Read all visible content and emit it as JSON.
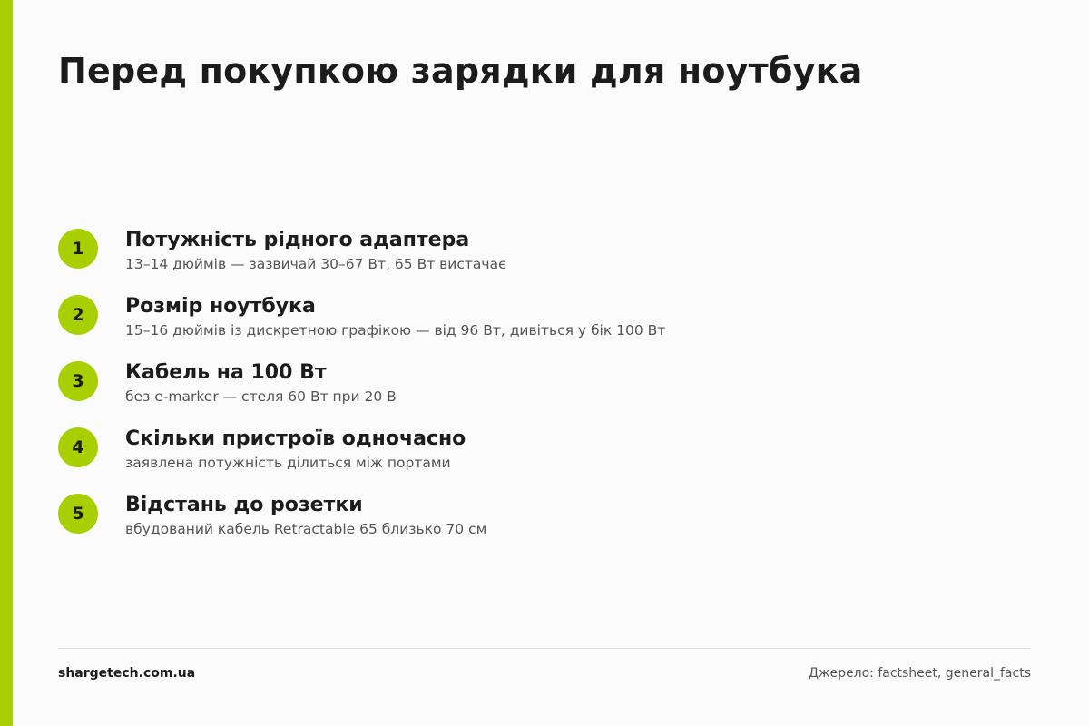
{
  "colors": {
    "accent": "#a8cf00",
    "background": "#fbfbfb",
    "text_primary": "#1c1c1c",
    "text_secondary": "#555555"
  },
  "header": {
    "title": "Перед покупкою зарядки для ноутбука"
  },
  "steps": [
    {
      "number": "1",
      "title": "Потужність рідного адаптера",
      "description": "13–14 дюймів — зазвичай 30–67 Вт, 65 Вт вистачає"
    },
    {
      "number": "2",
      "title": "Розмір ноутбука",
      "description": "15–16 дюймів із дискретною графікою — від 96 Вт, дивіться у бік 100 Вт"
    },
    {
      "number": "3",
      "title": "Кабель на 100 Вт",
      "description": "без e-marker — стеля 60 Вт при 20 В"
    },
    {
      "number": "4",
      "title": "Скільки пристроїв одночасно",
      "description": "заявлена потужність ділиться між портами"
    },
    {
      "number": "5",
      "title": "Відстань до розетки",
      "description": "вбудований кабель Retractable 65 близько 70 см"
    }
  ],
  "footer": {
    "site": "shargetech.com.ua",
    "source": "Джерело: factsheet, general_facts"
  }
}
